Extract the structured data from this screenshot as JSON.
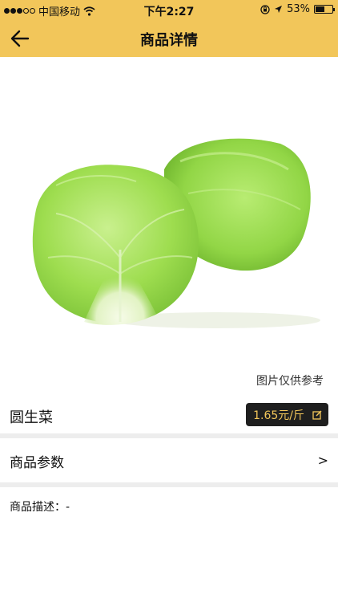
{
  "status_bar": {
    "carrier": "中国移动",
    "time": "下午2:27",
    "battery_percent": "53%",
    "battery_level": 0.53,
    "icons": [
      "signal-dots",
      "wifi-icon",
      "rotation-lock-icon",
      "location-arrow-icon",
      "battery-icon"
    ]
  },
  "nav": {
    "title": "商品详情",
    "back_icon": "arrow-left-icon"
  },
  "product": {
    "image_note": "图片仅供参考",
    "name": "圆生菜",
    "price": "1.65元/斤",
    "price_icon": "edit-icon"
  },
  "params": {
    "label": "商品参数",
    "chevron": ">"
  },
  "description": {
    "text": "商品描述：-"
  },
  "colors": {
    "header": "#f2c65a",
    "price_badge_bg": "#1f1f1f",
    "price_text": "#f2c65a",
    "divider": "#ededed",
    "lettuce": "#9cdc4e"
  }
}
